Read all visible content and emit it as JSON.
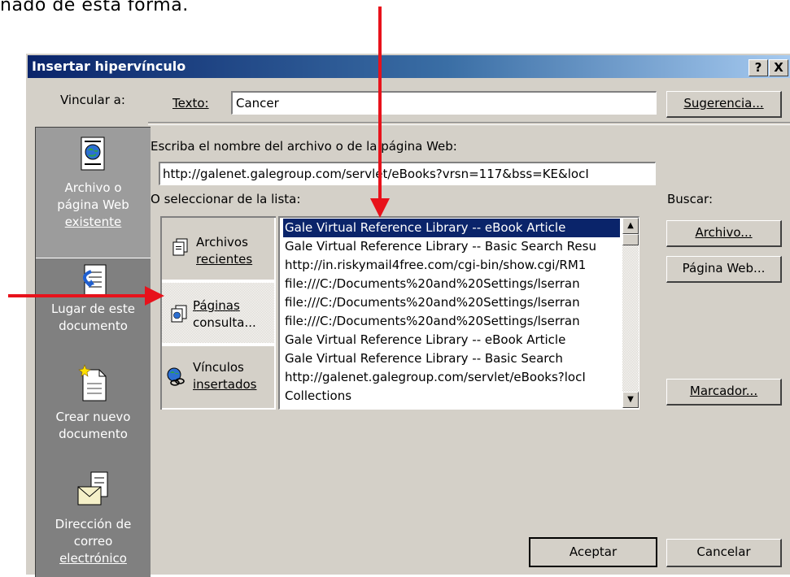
{
  "caption": "nado de esta forma.",
  "dialog": {
    "title": "Insertar hipervínculo",
    "help_button": "?",
    "close_button": "X"
  },
  "left_nav": {
    "heading": "Vincular a:",
    "items": [
      {
        "line1": "Archivo o",
        "line2": "página Web",
        "line3": "existente",
        "icon": "web-file-icon",
        "selected": true
      },
      {
        "line1": "Lugar de este",
        "line2": "documento",
        "icon": "document-place-icon"
      },
      {
        "line1": "Crear nuevo",
        "line2": "documento",
        "icon": "new-document-icon"
      },
      {
        "line1": "Dirección de",
        "line2": "correo",
        "line3": "electrónico",
        "icon": "email-icon"
      }
    ]
  },
  "texto": {
    "label": "Texto:",
    "value": "Cancer",
    "suggestion_button": "Sugerencia..."
  },
  "address": {
    "label": "Escriba el nombre del archivo o de la página Web:",
    "value": "http://galenet.galegroup.com/servlet/eBooks?vrsn=117&bss=KE&locI"
  },
  "list_label": "O seleccionar de la lista:",
  "buscar": {
    "label": "Buscar:",
    "file_button": "Archivo...",
    "web_button": "Página Web...",
    "bookmark_button": "Marcador..."
  },
  "sources": [
    {
      "line1": "Archivos",
      "line2": "recientes",
      "icon": "recent-files-icon"
    },
    {
      "line1": "Páginas",
      "line2": "consulta...",
      "icon": "browsed-pages-icon",
      "selected": true
    },
    {
      "line1": "Vínculos",
      "line2": "insertados",
      "icon": "inserted-links-icon"
    }
  ],
  "list_items": [
    "Gale Virtual Reference Library -- eBook Article",
    "Gale Virtual Reference Library -- Basic Search Resu",
    "http://in.riskymail4free.com/cgi-bin/show.cgi/RM1",
    "file:///C:/Documents%20and%20Settings/lserran",
    "file:///C:/Documents%20and%20Settings/lserran",
    "file:///C:/Documents%20and%20Settings/lserran",
    "Gale Virtual Reference Library -- eBook Article",
    "Gale Virtual Reference Library -- Basic Search",
    "http://galenet.galegroup.com/servlet/eBooks?locI",
    "Collections"
  ],
  "footer": {
    "ok_button": "Aceptar",
    "cancel_button": "Cancelar"
  },
  "colors": {
    "annotation_arrow": "#e8121b",
    "title_bar": "#0a246a",
    "selection": "#0a246a",
    "dialog_face": "#d4d0c8"
  }
}
